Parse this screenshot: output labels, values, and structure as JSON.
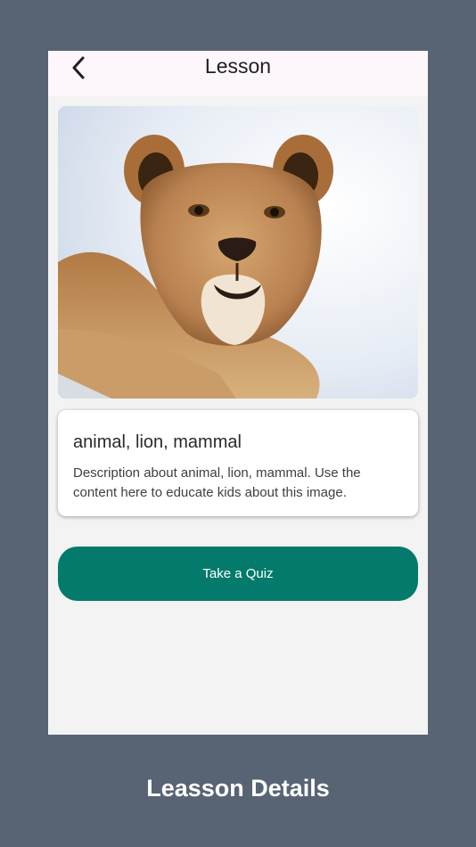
{
  "appbar": {
    "back_icon": "chevron-left-icon",
    "title": "Lesson"
  },
  "lesson": {
    "image_subject": "lion",
    "title": "animal, lion, mammal",
    "description": "Description about animal, lion, mammal. Use the content here to educate kids about this image."
  },
  "actions": {
    "quiz_label": "Take a Quiz"
  },
  "caption": "Leasson Details",
  "colors": {
    "background": "#586474",
    "app_background": "#f3f3f3",
    "appbar_background": "#fdf7fc",
    "primary_button": "#047a6c",
    "card_background": "#ffffff"
  }
}
